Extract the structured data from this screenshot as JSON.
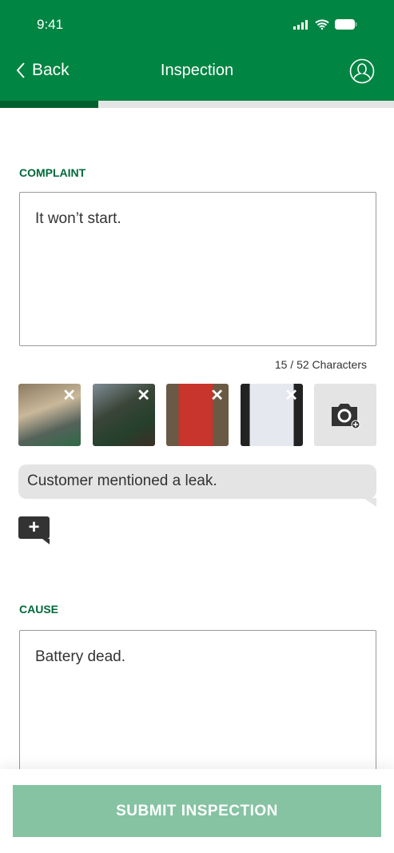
{
  "status_bar": {
    "time": "9:41"
  },
  "nav": {
    "back_label": "Back",
    "title": "Inspection"
  },
  "progress": {
    "fraction": 0.25
  },
  "complaint": {
    "label": "COMPLAINT",
    "value": "It won’t start.",
    "counter": "15 / 52 Characters",
    "photos": [
      {
        "alt": "engine"
      },
      {
        "alt": "tractor"
      },
      {
        "alt": "multimeter"
      },
      {
        "alt": "document"
      }
    ],
    "note": "Customer mentioned a leak."
  },
  "cause": {
    "label": "CAUSE",
    "value": "Battery dead."
  },
  "footer": {
    "submit_label": "SUBMIT INSPECTION"
  },
  "colors": {
    "brand": "#008542",
    "submit": "#85c3a2"
  }
}
